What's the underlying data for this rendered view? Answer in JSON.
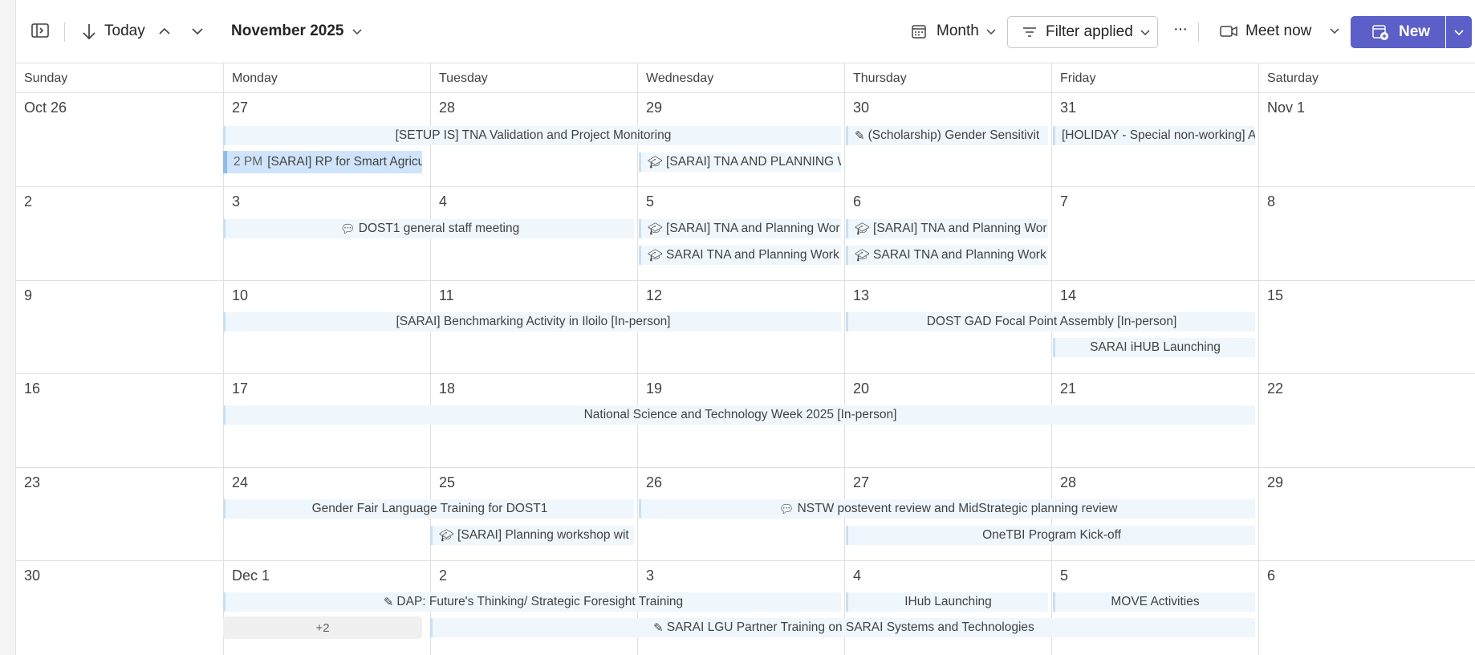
{
  "toolbar": {
    "today_label": "Today",
    "month_year": "November 2025",
    "view_label": "Month",
    "filter_label": "Filter applied",
    "more_label": "···",
    "meet_label": "Meet now",
    "new_label": "New"
  },
  "day_headers": [
    "Sunday",
    "Monday",
    "Tuesday",
    "Wednesday",
    "Thursday",
    "Friday",
    "Saturday"
  ],
  "weeks": [
    {
      "days": [
        "Oct 26",
        "27",
        "28",
        "29",
        "30",
        "31",
        "Nov 1"
      ]
    },
    {
      "days": [
        "2",
        "3",
        "4",
        "5",
        "6",
        "7",
        "8"
      ]
    },
    {
      "days": [
        "9",
        "10",
        "11",
        "12",
        "13",
        "14",
        "15"
      ]
    },
    {
      "days": [
        "16",
        "17",
        "18",
        "19",
        "20",
        "21",
        "22"
      ]
    },
    {
      "days": [
        "23",
        "24",
        "25",
        "26",
        "27",
        "28",
        "29"
      ]
    },
    {
      "days": [
        "30",
        "Dec 1",
        "2",
        "3",
        "4",
        "5",
        "6"
      ]
    }
  ],
  "events": {
    "w1_setup": "[SETUP IS] TNA Validation and Project Monitoring",
    "w1_scholar": "(Scholarship) Gender Sensitivit",
    "w1_holiday": "[HOLIDAY - Special non-working] A",
    "w1_rp_time": "2 PM",
    "w1_rp": "[SARAI] RP for Smart Agricu",
    "w1_tna": "[SARAI] TNA AND PLANNING W",
    "w2_staff": "DOST1 general staff meeting",
    "w2_tna1": "[SARAI] TNA and Planning Wor",
    "w2_tna2": "[SARAI] TNA and Planning Wor",
    "w2_tna3": "SARAI TNA and Planning Work",
    "w2_tna4": "SARAI TNA and Planning Work",
    "w3_bench": "[SARAI] Benchmarking Activity in Iloilo [In-person]",
    "w3_gad": "DOST GAD Focal Point Assembly [In-person]",
    "w3_ihub": "SARAI iHUB Launching",
    "w4_nstw": "National Science and Technology Week 2025 [In-person]",
    "w5_gfl": "Gender Fair Language Training for DOST1",
    "w5_nstw_review": "NSTW postevent review and MidStrategic planning review",
    "w5_planning": "[SARAI] Planning workshop wit",
    "w5_onetbi": "OneTBI Program Kick-off",
    "w6_dap": "DAP: Future's Thinking/ Strategic Foresight Training",
    "w6_ihub": "IHub Launching",
    "w6_move": "MOVE Activities",
    "w6_more": "+2",
    "w6_lgu": "SARAI LGU Partner Training on SARAI Systems and Technologies"
  },
  "colors": {
    "accent": "#5b5fc7",
    "event_bg": "#eff6fc",
    "event_bar": "#c8e0f4"
  }
}
